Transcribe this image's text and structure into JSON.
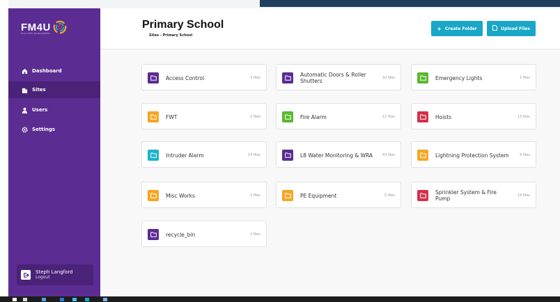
{
  "app": {
    "logo_text": "FM4U",
    "logo_tagline": "FACILITIES MANAGEMENT"
  },
  "colors": {
    "sidebar": "#5b2c91",
    "sidebar_active": "#4a2278",
    "accent": "#1aa7c7",
    "folder_purple": "#5b2c91",
    "folder_orange": "#f5a623",
    "folder_green": "#5cb82e",
    "folder_red": "#d4304a",
    "folder_teal": "#1ab3c9"
  },
  "sidebar": {
    "items": [
      {
        "label": "Dashboard",
        "icon": "dashboard-icon",
        "active": false
      },
      {
        "label": "Sites",
        "icon": "building-icon",
        "active": true
      },
      {
        "label": "Users",
        "icon": "user-icon",
        "active": false
      },
      {
        "label": "Settings",
        "icon": "gear-icon",
        "active": false
      }
    ],
    "user": {
      "name": "Steph Langford",
      "logout_label": "Logout",
      "icon": "logout-icon"
    }
  },
  "header": {
    "title": "Primary School",
    "breadcrumb": "Sites - Primary School",
    "create_folder_label": "Create Folder",
    "create_folder_icon": "plus-icon",
    "upload_files_label": "Upload Files",
    "upload_files_icon": "file-icon"
  },
  "folders": [
    {
      "name": "Access Control",
      "count": "3 files",
      "color": "purple"
    },
    {
      "name": "Automatic Doors & Roller Shutters",
      "count": "10 files",
      "color": "purple"
    },
    {
      "name": "Emergency Lights",
      "count": "1 files",
      "color": "green"
    },
    {
      "name": "FWT",
      "count": "1 files",
      "color": "orange"
    },
    {
      "name": "Fire Alarm",
      "count": "12 files",
      "color": "green"
    },
    {
      "name": "Hoists",
      "count": "13 files",
      "color": "red"
    },
    {
      "name": "Intruder Alarm",
      "count": "14 files",
      "color": "teal"
    },
    {
      "name": "L8 Water Monitoring & WRA",
      "count": "43 files",
      "color": "purple"
    },
    {
      "name": "Lightning Protection System",
      "count": "4 files",
      "color": "orange"
    },
    {
      "name": "Misc Works",
      "count": "3 files",
      "color": "orange"
    },
    {
      "name": "PE Equipment",
      "count": "5 files",
      "color": "orange"
    },
    {
      "name": "Sprinkler System & Fire Pump",
      "count": "14 files",
      "color": "red"
    },
    {
      "name": "recycle_bin",
      "count": "2 files",
      "color": "purple"
    }
  ]
}
